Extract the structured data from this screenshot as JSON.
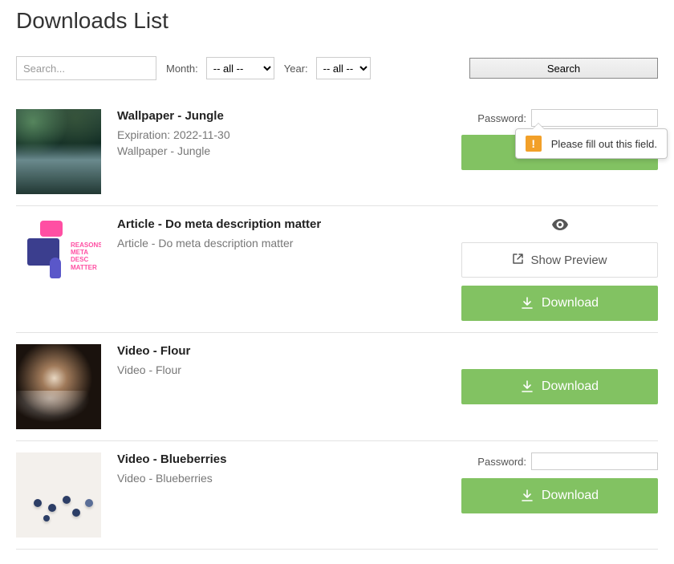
{
  "page_title": "Downloads List",
  "filters": {
    "search_placeholder": "Search...",
    "month_label": "Month:",
    "month_selected": "-- all --",
    "year_label": "Year:",
    "year_selected": "-- all --",
    "search_btn": "Search"
  },
  "labels": {
    "password": "Password:",
    "download": "Download",
    "show_preview": "Show Preview"
  },
  "tooltip": {
    "text": "Please fill out this field.",
    "warn_glyph": "!"
  },
  "items": [
    {
      "title": "Wallpaper - Jungle",
      "expiration": "Expiration: 2022-11-30",
      "description": "Wallpaper - Jungle",
      "has_password": true,
      "has_preview": false,
      "has_eye": false,
      "show_tooltip": true
    },
    {
      "title": "Article - Do meta description matter",
      "expiration": "",
      "description": "Article - Do meta description matter",
      "has_password": false,
      "has_preview": true,
      "has_eye": true,
      "show_tooltip": false
    },
    {
      "title": "Video - Flour",
      "expiration": "",
      "description": "Video - Flour",
      "has_password": false,
      "has_preview": false,
      "has_eye": false,
      "show_tooltip": false
    },
    {
      "title": "Video - Blueberries",
      "expiration": "",
      "description": "Video - Blueberries",
      "has_password": true,
      "has_preview": false,
      "has_eye": false,
      "show_tooltip": false
    }
  ],
  "article_caption": "REASONS META DESC MATTER"
}
